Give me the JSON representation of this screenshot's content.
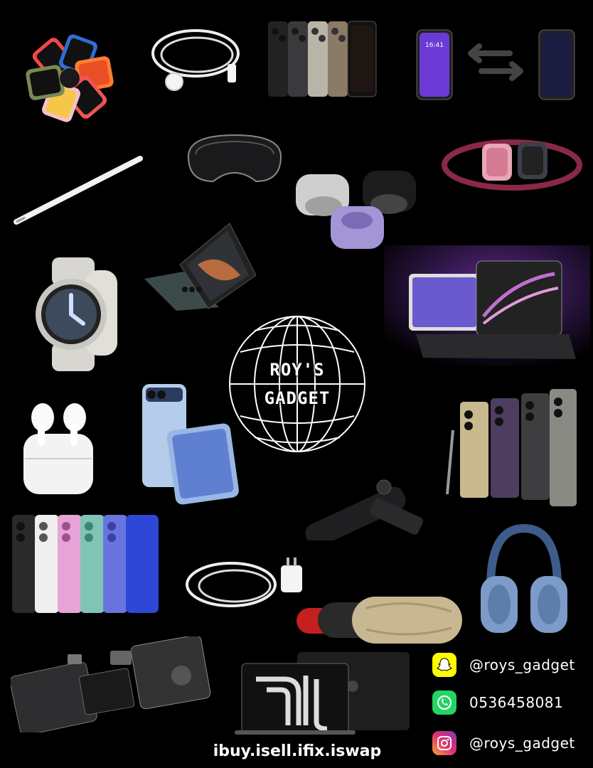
{
  "brand": {
    "line1": "ROY'S",
    "line2": "GADGET"
  },
  "contacts": [
    {
      "platform": "snapchat-icon",
      "text": "@roys_gadget",
      "color": "#FFFC00"
    },
    {
      "platform": "whatsapp-icon",
      "text": "0536458081",
      "color": "#25D366"
    },
    {
      "platform": "instagram-icon",
      "text": "@roys_gadget",
      "color": "#C13584"
    }
  ],
  "tagline": "ibuy.isell.ifix.iswap",
  "phone_screen_time": "16:41"
}
